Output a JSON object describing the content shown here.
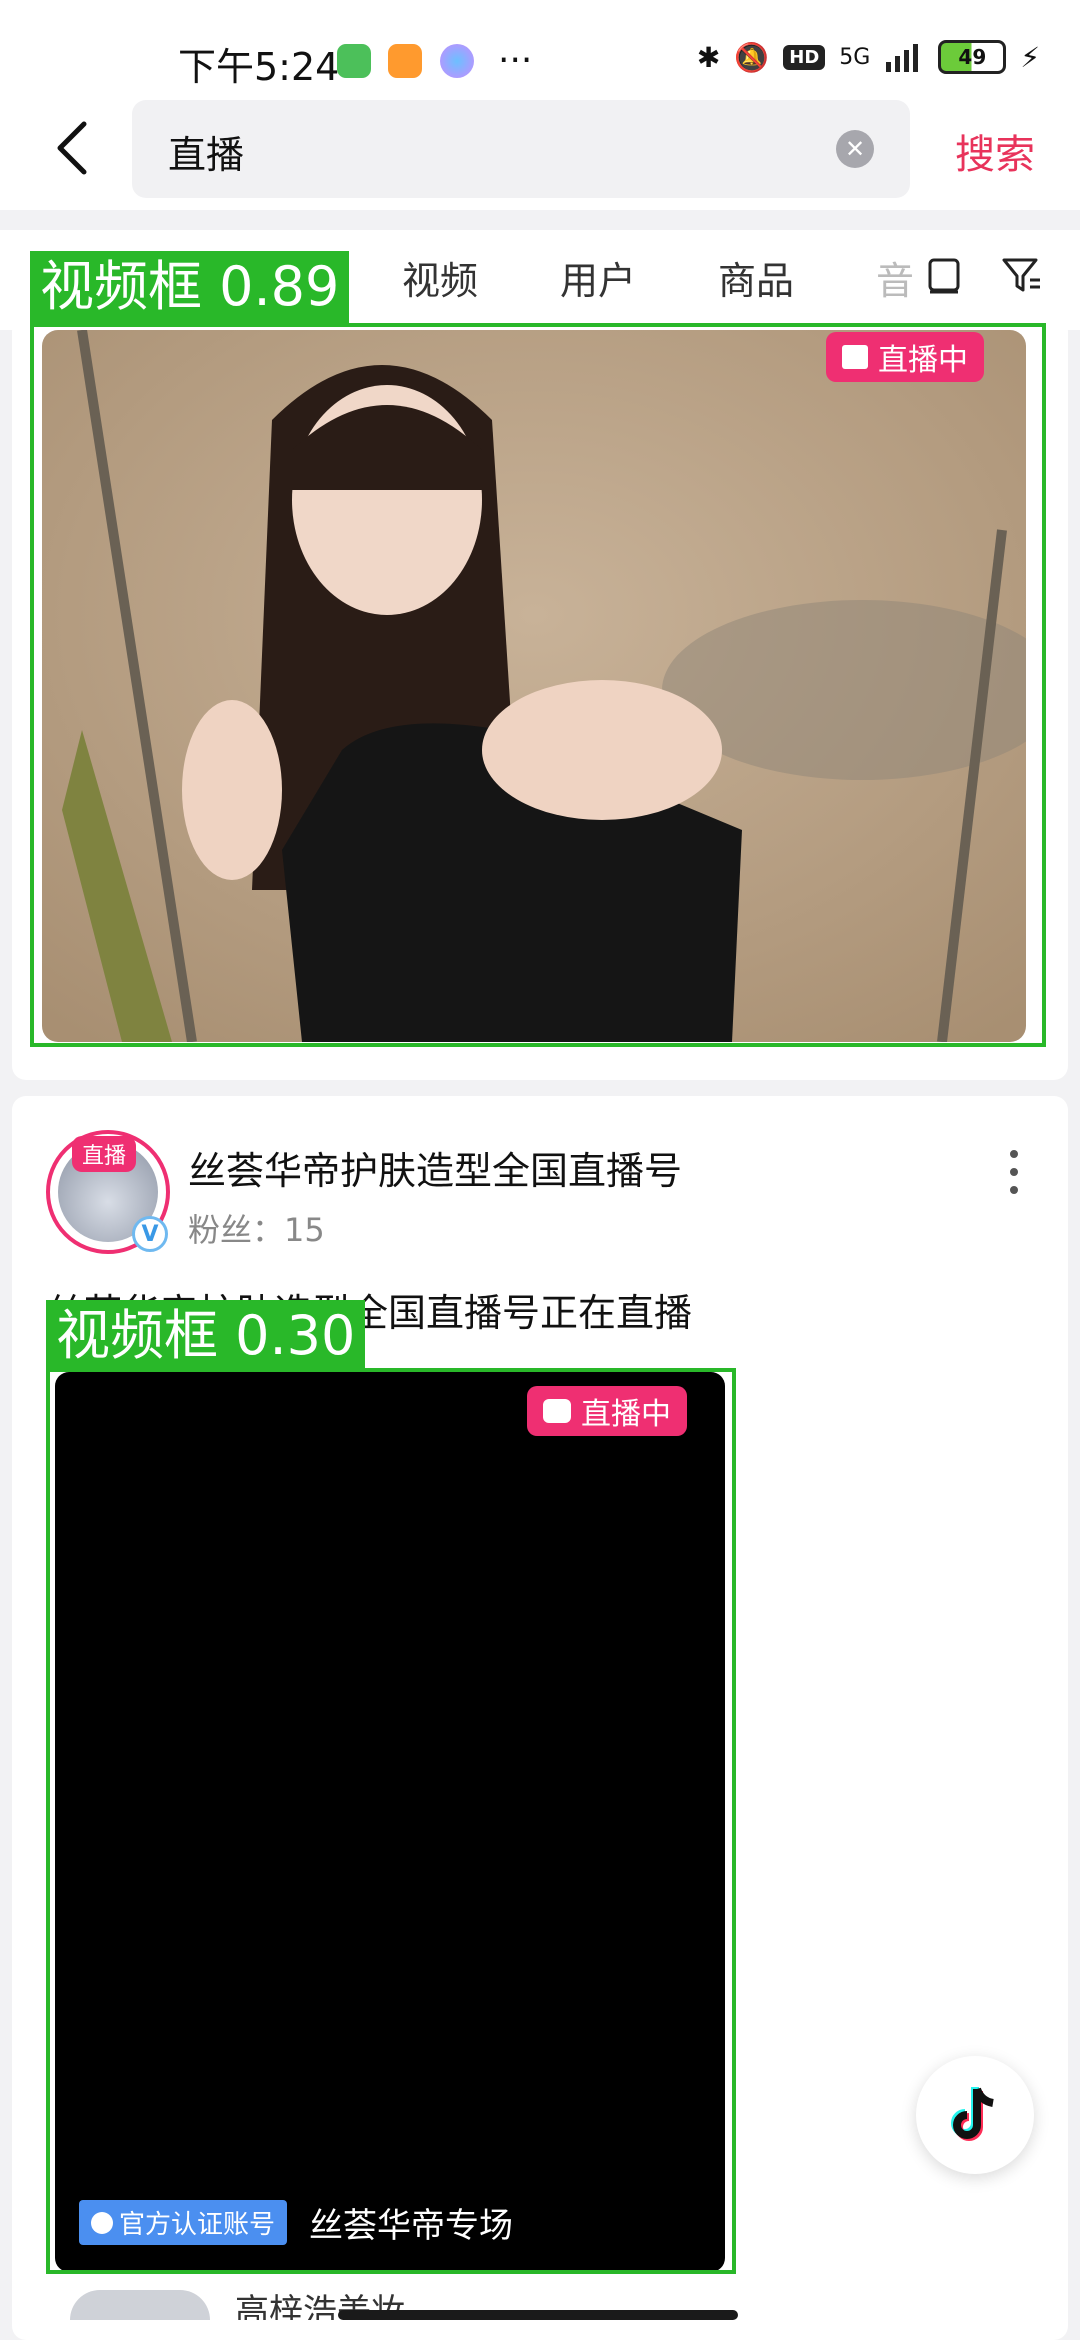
{
  "status_bar": {
    "time": "下午5:24",
    "network": "5G",
    "hd": "HD",
    "battery": "49"
  },
  "search": {
    "query": "直播",
    "button": "搜索"
  },
  "tabs": [
    "视频",
    "用户",
    "商品",
    "音"
  ],
  "card1": {
    "live_badge": "直播中"
  },
  "card2": {
    "account_name": "丝荟华帝护肤造型全国直播号",
    "fans_label": "粉丝：",
    "fans_count": "15",
    "avatar_badge": "直播",
    "description": "丝荟华帝护肤造型全国直播号正在直播",
    "live_badge": "直播中",
    "official_tag": "官方认证账号",
    "host_name": "丝荟华帝专场",
    "peek_text": "高梓浩美妆"
  },
  "detections": [
    {
      "label": "视频框 0.89"
    },
    {
      "label": "视频框 0.30"
    }
  ],
  "colors": {
    "accent": "#e8335b",
    "live_badge": "#ef2f72",
    "detect_box": "#29b829"
  }
}
